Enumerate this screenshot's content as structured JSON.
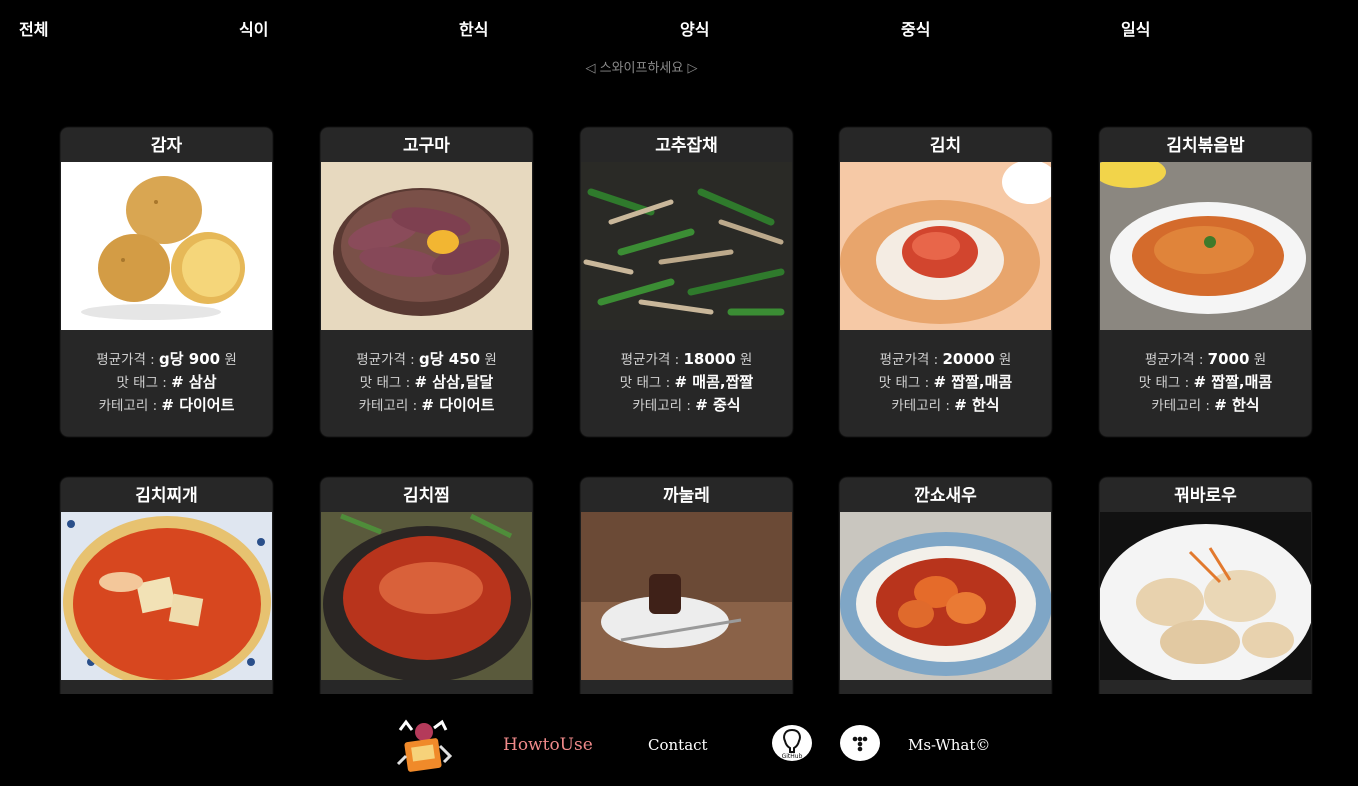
{
  "nav": {
    "tabs": [
      "전체",
      "식이",
      "한식",
      "양식",
      "중식",
      "일식"
    ]
  },
  "swipe_hint": "◁ 스와이프하세요 ▷",
  "labels": {
    "price": "평균가격 : ",
    "tag": "맛 태그 : ",
    "category": "카테고리 : ",
    "won": " 원"
  },
  "cards": [
    {
      "name": "감자",
      "price": "g당 900",
      "tags": "# 삼삼",
      "category": "# 다이어트",
      "image": "potato"
    },
    {
      "name": "고구마",
      "price": "g당 450",
      "tags": "# 삼삼,달달",
      "category": "# 다이어트",
      "image": "sweet-potato"
    },
    {
      "name": "고추잡채",
      "price": "18000",
      "tags": "# 매콤,짭짤",
      "category": "# 중식",
      "image": "gochujapchae"
    },
    {
      "name": "김치",
      "price": "20000",
      "tags": "# 짭짤,매콤",
      "category": "# 한식",
      "image": "kimchi"
    },
    {
      "name": "김치볶음밥",
      "price": "7000",
      "tags": "# 짭짤,매콤",
      "category": "# 한식",
      "image": "kimchi-fried-rice"
    },
    {
      "name": "김치찌개",
      "price": "",
      "tags": "",
      "category": "",
      "image": "kimchi-stew"
    },
    {
      "name": "김치찜",
      "price": "",
      "tags": "",
      "category": "",
      "image": "braised-kimchi"
    },
    {
      "name": "까눌레",
      "price": "",
      "tags": "",
      "category": "",
      "image": "canele"
    },
    {
      "name": "깐쇼새우",
      "price": "",
      "tags": "",
      "category": "",
      "image": "chili-shrimp"
    },
    {
      "name": "꿔바로우",
      "price": "",
      "tags": "",
      "category": "",
      "image": "guobaorou"
    }
  ],
  "footer": {
    "howto": "HowtoUse",
    "contact": "Contact",
    "github_label": "GitHub",
    "copyright": "Ms-What©"
  },
  "colors": {
    "background": "#000000",
    "card": "#272727",
    "howto_accent": "#f08a8a"
  }
}
